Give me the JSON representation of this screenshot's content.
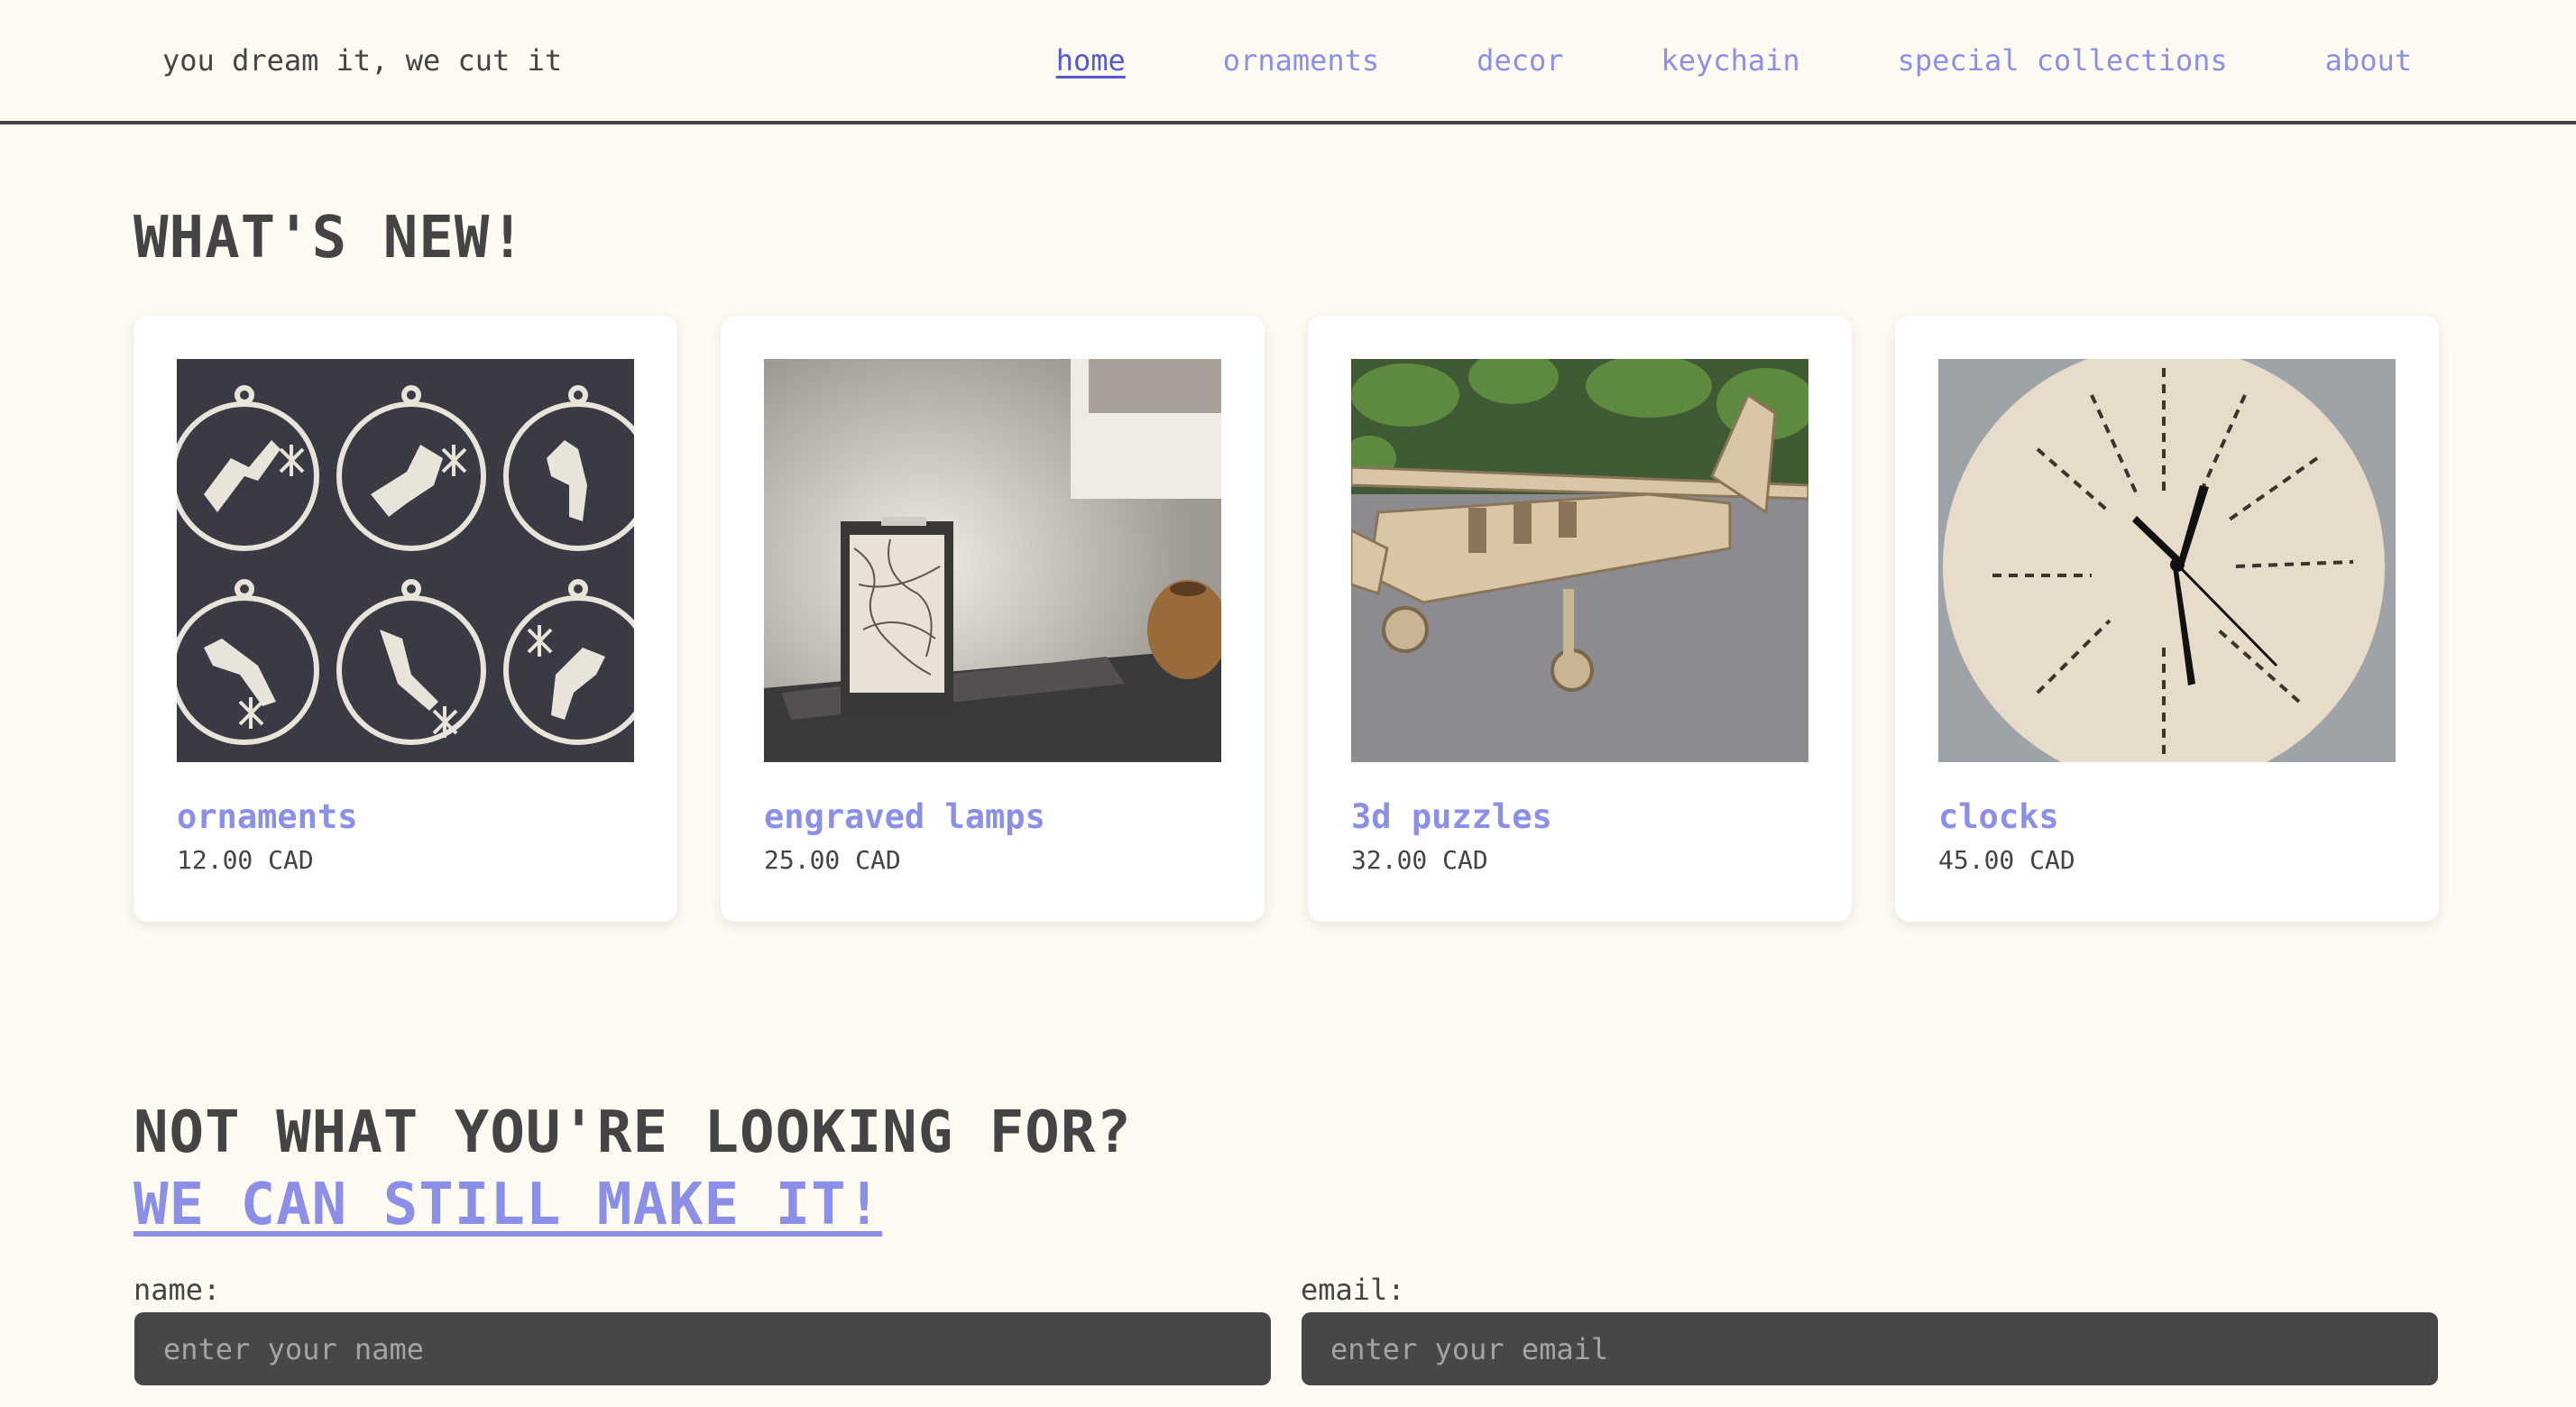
{
  "header": {
    "tagline": "you dream it, we cut it",
    "nav": [
      {
        "label": "home",
        "active": true
      },
      {
        "label": "ornaments"
      },
      {
        "label": "decor"
      },
      {
        "label": "keychain"
      },
      {
        "label": "special collections"
      },
      {
        "label": "about"
      }
    ]
  },
  "whats_new": {
    "title": "WHAT'S NEW!",
    "products": [
      {
        "name": "ornaments",
        "price": "12.00 CAD",
        "image": "ornaments-photo"
      },
      {
        "name": "engraved lamps",
        "price": "25.00 CAD",
        "image": "lamp-photo"
      },
      {
        "name": "3d puzzles",
        "price": "32.00 CAD",
        "image": "airplane-puzzle-photo"
      },
      {
        "name": "clocks",
        "price": "45.00 CAD",
        "image": "wooden-clock-photo"
      }
    ]
  },
  "custom_order": {
    "title": "NOT WHAT YOU'RE LOOKING FOR?",
    "cta": "WE CAN STILL MAKE IT!",
    "name_label": "name:",
    "name_placeholder": "enter your name",
    "email_label": "email:",
    "email_placeholder": "enter your email"
  },
  "colors": {
    "background": "#fdfaf2",
    "accent": "#8c8fe8",
    "accent_active": "#5559d0",
    "text": "#444444",
    "input_bg": "#474747"
  }
}
